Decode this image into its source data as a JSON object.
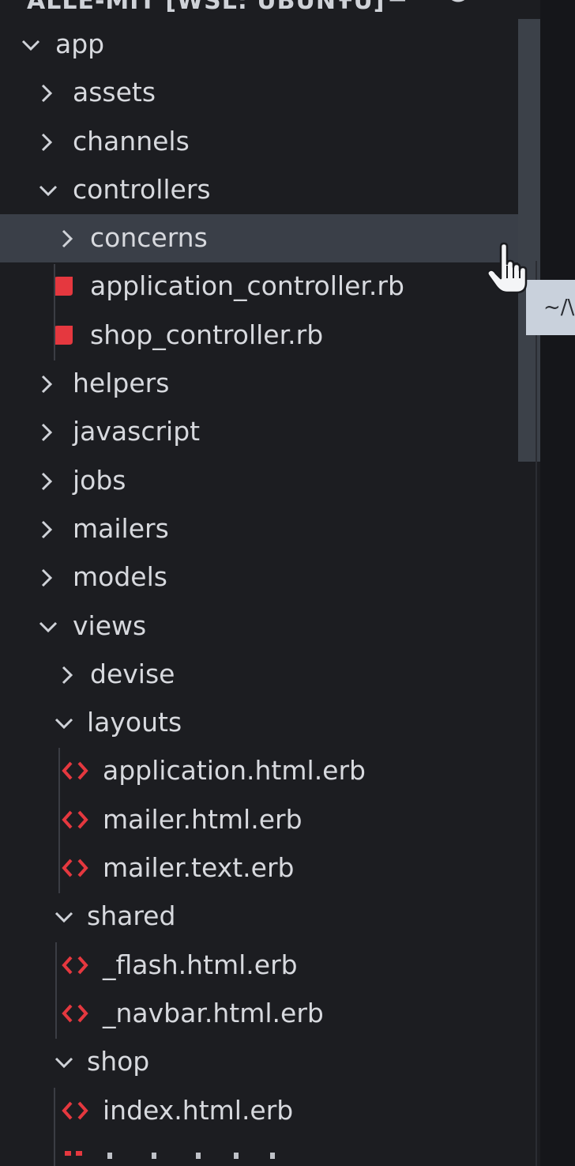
{
  "header": {
    "title": "ALLE-MIT [WSL: UBUNTU]",
    "actions": [
      "new-file-icon",
      "new-folder-icon",
      "refresh-icon",
      "collapse-all-icon"
    ]
  },
  "tree": [
    {
      "label": "app",
      "kind": "folder",
      "expanded": true,
      "depth": 0
    },
    {
      "label": "assets",
      "kind": "folder",
      "expanded": false,
      "depth": 1
    },
    {
      "label": "channels",
      "kind": "folder",
      "expanded": false,
      "depth": 1
    },
    {
      "label": "controllers",
      "kind": "folder",
      "expanded": true,
      "depth": 1
    },
    {
      "label": "concerns",
      "kind": "folder",
      "expanded": false,
      "depth": 2,
      "selected": true
    },
    {
      "label": "application_controller.rb",
      "kind": "ruby",
      "depth": 2
    },
    {
      "label": "shop_controller.rb",
      "kind": "ruby",
      "depth": 2
    },
    {
      "label": "helpers",
      "kind": "folder",
      "expanded": false,
      "depth": 1
    },
    {
      "label": "javascript",
      "kind": "folder",
      "expanded": false,
      "depth": 1
    },
    {
      "label": "jobs",
      "kind": "folder",
      "expanded": false,
      "depth": 1
    },
    {
      "label": "mailers",
      "kind": "folder",
      "expanded": false,
      "depth": 1
    },
    {
      "label": "models",
      "kind": "folder",
      "expanded": false,
      "depth": 1
    },
    {
      "label": "views",
      "kind": "folder",
      "expanded": true,
      "depth": 1
    },
    {
      "label": "devise",
      "kind": "folder",
      "expanded": false,
      "depth": 2
    },
    {
      "label": "layouts",
      "kind": "folder",
      "expanded": true,
      "depth": 2
    },
    {
      "label": "application.html.erb",
      "kind": "erb",
      "depth": 3
    },
    {
      "label": "mailer.html.erb",
      "kind": "erb",
      "depth": 3
    },
    {
      "label": "mailer.text.erb",
      "kind": "erb",
      "depth": 3
    },
    {
      "label": "shared",
      "kind": "folder",
      "expanded": true,
      "depth": 2
    },
    {
      "label": "_flash.html.erb",
      "kind": "erb",
      "depth": 3
    },
    {
      "label": "_navbar.html.erb",
      "kind": "erb",
      "depth": 3
    },
    {
      "label": "shop",
      "kind": "folder",
      "expanded": true,
      "depth": 2
    },
    {
      "label": "index.html.erb",
      "kind": "erb",
      "depth": 3
    }
  ],
  "tooltip": {
    "text": "~/\\"
  },
  "colors": {
    "background": "#1c1d21",
    "selected_row": "#3a3f48",
    "ruby_icon": "#e5383f",
    "erb_icon": "#e5383f",
    "text": "#d7d9de"
  }
}
